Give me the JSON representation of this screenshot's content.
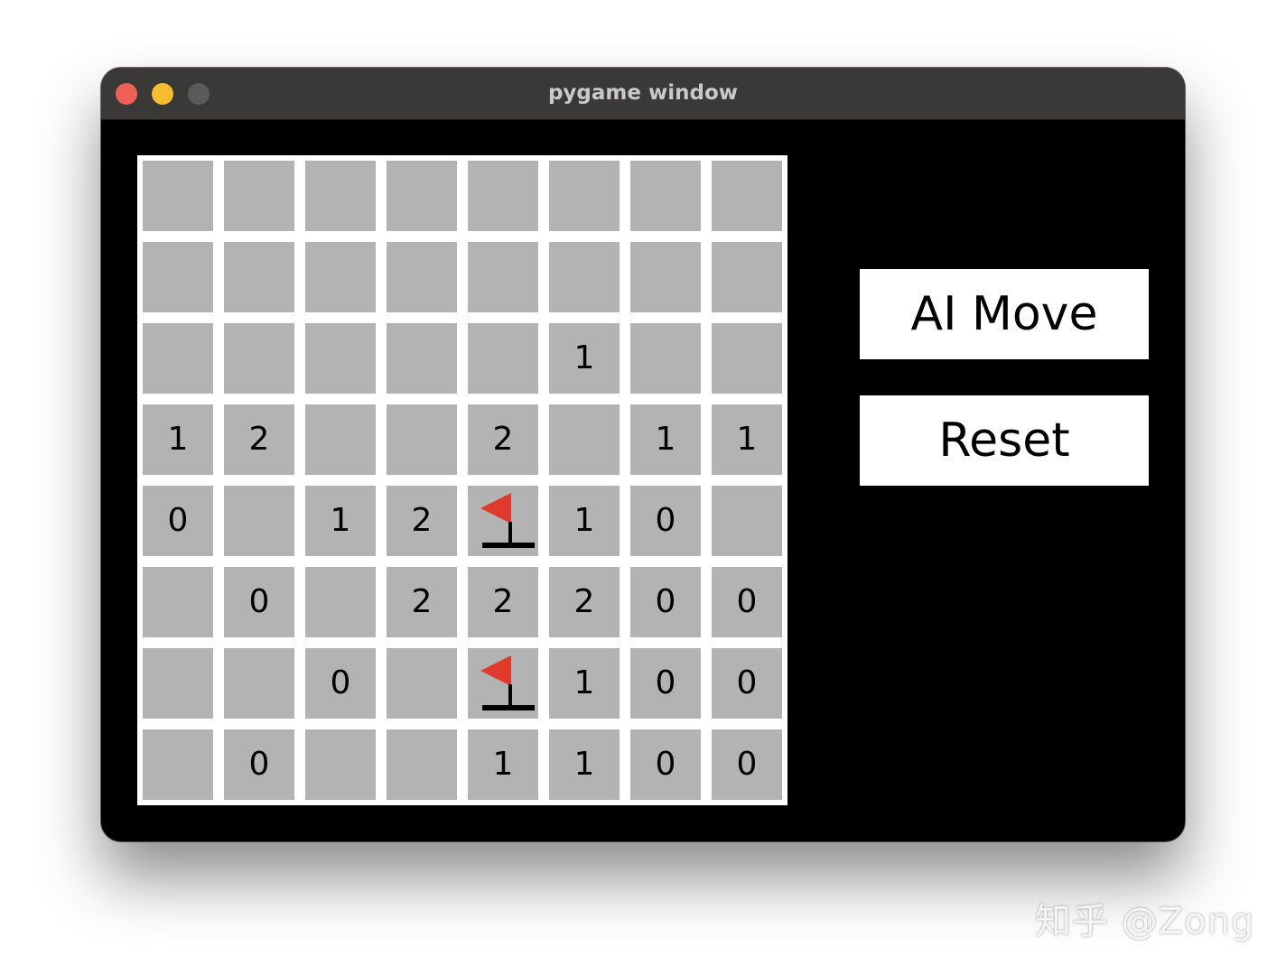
{
  "window": {
    "title": "pygame window",
    "controls": [
      {
        "name": "close",
        "color": "#ee5f57"
      },
      {
        "name": "minimize",
        "color": "#f5bd30"
      },
      {
        "name": "zoom",
        "color": "#5b5a59"
      }
    ]
  },
  "board": {
    "cell_color": "#b3b3b3",
    "grid_color": "#ffffff",
    "flag_color": "#e03a2c",
    "rows": [
      [
        "",
        "",
        "",
        "",
        "",
        "",
        "",
        ""
      ],
      [
        "",
        "",
        "",
        "",
        "",
        "",
        "",
        ""
      ],
      [
        "",
        "",
        "",
        "",
        "",
        "1",
        "",
        ""
      ],
      [
        "1",
        "2",
        "",
        "",
        "2",
        "",
        "1",
        "1"
      ],
      [
        "0",
        "",
        "1",
        "2",
        "F",
        "1",
        "0",
        ""
      ],
      [
        "",
        "0",
        "",
        "2",
        "2",
        "2",
        "0",
        "0"
      ],
      [
        "",
        "",
        "0",
        "",
        "F",
        "1",
        "0",
        "0"
      ],
      [
        "",
        "0",
        "",
        "",
        "1",
        "1",
        "0",
        "0"
      ]
    ]
  },
  "buttons": {
    "ai_move": "AI Move",
    "reset": "Reset"
  },
  "watermark": "知乎 @Zong"
}
